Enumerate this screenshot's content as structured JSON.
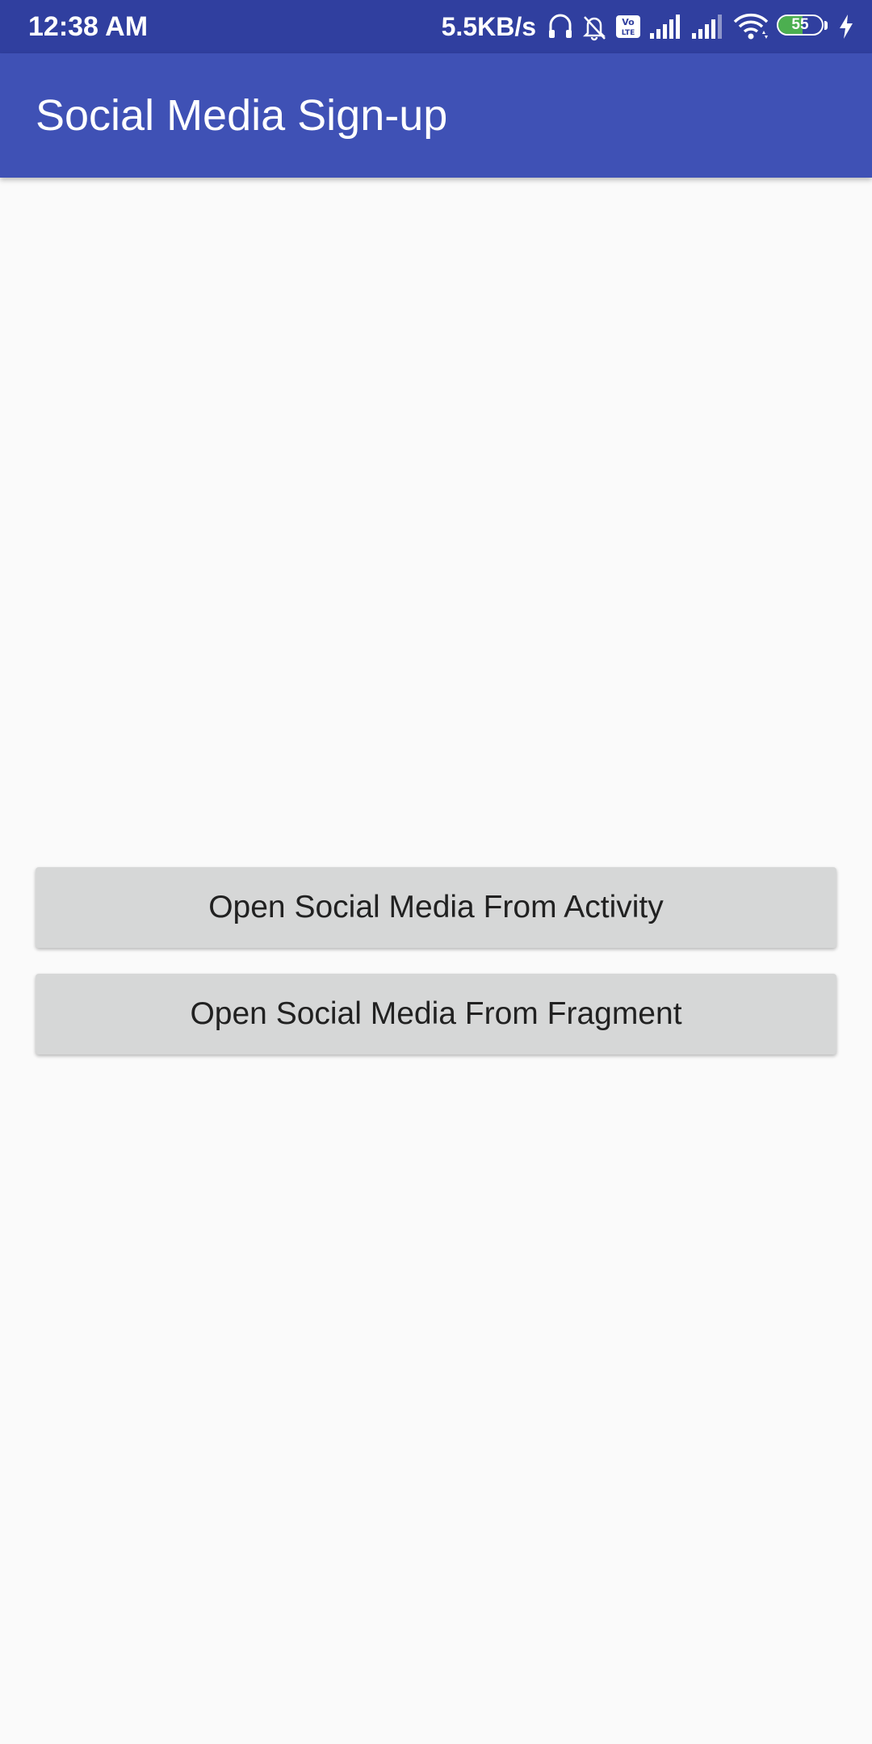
{
  "status_bar": {
    "time": "12:38 AM",
    "net_speed": "5.5KB/s",
    "battery_level": "55",
    "battery_fraction": 0.55,
    "colors": {
      "background": "#303F9F",
      "battery_fill": "#4CAF50"
    },
    "icons": [
      "headset-icon",
      "mute-bell-icon",
      "volte-icon",
      "signal-icon",
      "signal-icon",
      "wifi-icon",
      "battery-icon",
      "charging-icon"
    ]
  },
  "app_bar": {
    "title": "Social Media Sign-up",
    "color": "#3F51B5"
  },
  "main": {
    "buttons": [
      {
        "label": "Open Social Media From Activity"
      },
      {
        "label": "Open Social Media From Fragment"
      }
    ],
    "button_color": "#D6D7D7",
    "background": "#FAFAFA"
  }
}
